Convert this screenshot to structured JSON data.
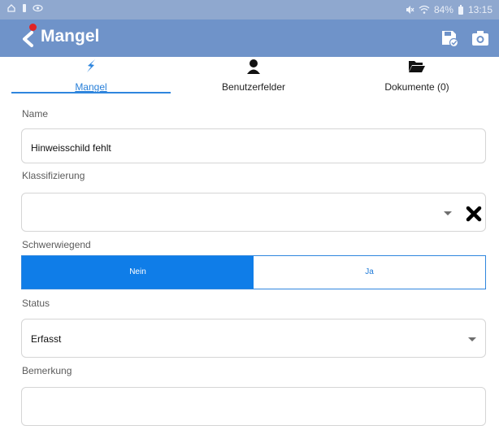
{
  "status_bar": {
    "battery": "84%",
    "time": "13:15",
    "icons": [
      "home-icon",
      "battery-small-icon",
      "eye-icon",
      "mute-icon",
      "wifi-icon",
      "battery-icon"
    ]
  },
  "app_bar": {
    "title": "Mangel",
    "actions": [
      "save-icon",
      "camera-icon"
    ]
  },
  "tabs": [
    {
      "label": "Mangel",
      "icon": "lightning-icon",
      "active": true
    },
    {
      "label": "Benutzerfelder",
      "icon": "user-icon",
      "active": false
    },
    {
      "label": "Dokumente (0)",
      "icon": "folder-icon",
      "active": false
    }
  ],
  "form": {
    "name_label": "Name",
    "name_value": "Hinweisschild fehlt",
    "klassifizierung_label": "Klassifizierung",
    "klassifizierung_value": "",
    "schwerwiegend_label": "Schwerwiegend",
    "schwerwiegend_options": [
      "Nein",
      "Ja"
    ],
    "schwerwiegend_selected": "Nein",
    "status_label": "Status",
    "status_value": "Erfasst",
    "bemerkung_label": "Bemerkung",
    "bemerkung_value": ""
  },
  "colors": {
    "status_bar": "#8fa8cf",
    "app_bar": "#6f93c9",
    "accent": "#0f7de8",
    "notification": "#e12424"
  }
}
